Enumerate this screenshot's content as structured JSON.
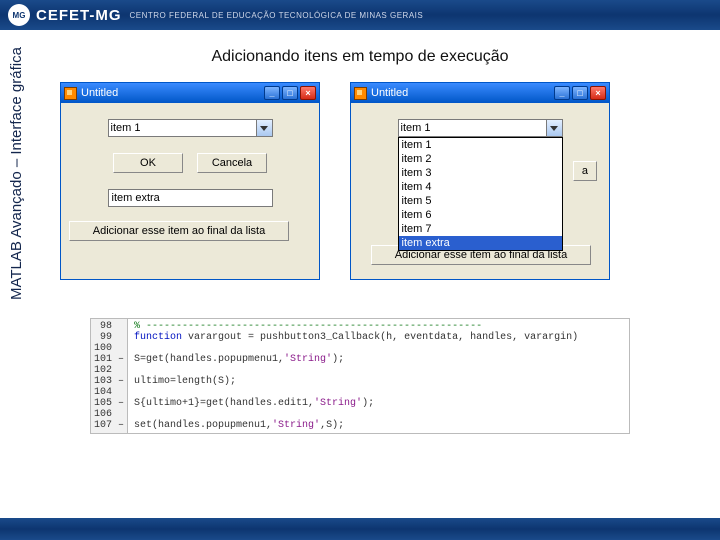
{
  "header": {
    "logo_name": "CEFET-MG",
    "logo_sub": "CENTRO FEDERAL DE EDUCAÇÃO TECNOLÓGICA DE MINAS GERAIS"
  },
  "vertical_label": "MATLAB  Avançado – Interface gráfica",
  "page_title": "Adicionando itens em tempo de execução",
  "window_left": {
    "title": "Untitled",
    "dropdown_selected": "item 1",
    "btn_ok": "OK",
    "btn_cancel": "Cancela",
    "extra_input_value": "item extra",
    "add_button": "Adicionar esse item ao final da lista"
  },
  "window_right": {
    "title": "Untitled",
    "dropdown_selected": "item 1",
    "dropdown_items": [
      "item 1",
      "item 2",
      "item 3",
      "item 4",
      "item 5",
      "item 6",
      "item 7",
      "item extra"
    ],
    "btn_cancel_stub": "a",
    "add_button": "Adicionar esse item ao final da lista"
  },
  "code": {
    "line_numbers": [
      "98",
      "99",
      "100",
      "101",
      "102",
      "103",
      "104",
      "105",
      "106",
      "107"
    ],
    "dash_marks": [
      false,
      false,
      false,
      true,
      false,
      true,
      false,
      true,
      false,
      true
    ],
    "l98": "% --------------------------------------------------------",
    "l99_a": "function",
    "l99_b": " varargout = pushbutton3_Callback(h, eventdata, handles, varargin)",
    "l101_a": "S=get(handles.popupmenu1,",
    "l101_b": "'String'",
    "l101_c": ");",
    "l103": "ultimo=length(S);",
    "l105_a": "S{ultimo+1}=get(handles.edit1,",
    "l105_b": "'String'",
    "l105_c": ");",
    "l107_a": "set(handles.popupmenu1,",
    "l107_b": "'String'",
    "l107_c": ",S);"
  }
}
